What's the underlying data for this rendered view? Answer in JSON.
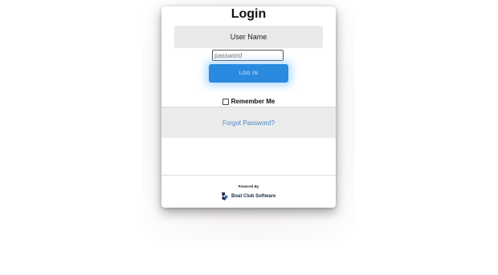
{
  "login": {
    "title": "Login",
    "username_placeholder": "User Name",
    "password_placeholder": "password",
    "login_button": "LOG IN",
    "remember_me": "Remember Me",
    "forgot_password": "Forgot Password?"
  },
  "footer": {
    "powered_by": "Powered By",
    "brand_name": "Boat Club Software",
    "brand_icon": "boat-club-logo-icon"
  },
  "colors": {
    "accent": "#2a8ae0",
    "link": "#4a86c8",
    "panel": "#ebebeb"
  }
}
